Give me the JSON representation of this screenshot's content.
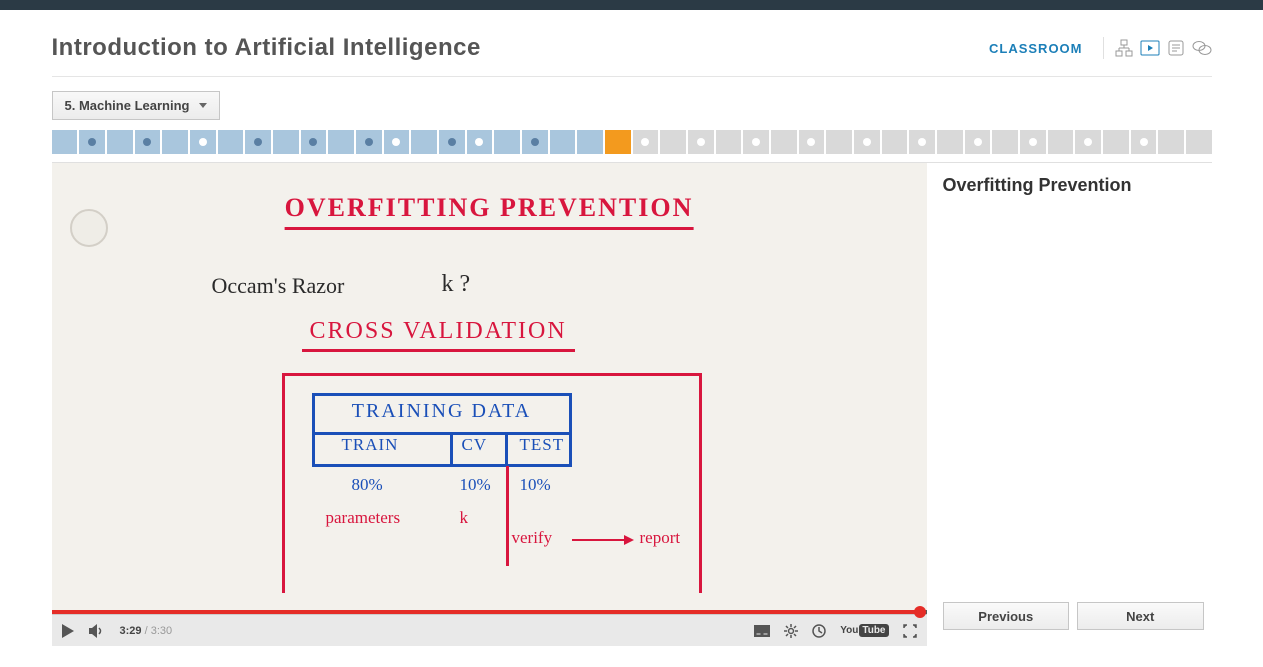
{
  "header": {
    "course_title": "Introduction to Artificial Intelligence",
    "classroom_label": "CLASSROOM"
  },
  "subnav": {
    "chapter_label": "5. Machine Learning"
  },
  "progress": {
    "segments": [
      {
        "state": "done",
        "marker": "none"
      },
      {
        "state": "done",
        "marker": "filled"
      },
      {
        "state": "done",
        "marker": "none"
      },
      {
        "state": "done",
        "marker": "filled"
      },
      {
        "state": "done",
        "marker": "none"
      },
      {
        "state": "done",
        "marker": "open"
      },
      {
        "state": "done",
        "marker": "none"
      },
      {
        "state": "done",
        "marker": "filled"
      },
      {
        "state": "done",
        "marker": "none"
      },
      {
        "state": "done",
        "marker": "filled"
      },
      {
        "state": "done",
        "marker": "none"
      },
      {
        "state": "done",
        "marker": "filled"
      },
      {
        "state": "done",
        "marker": "open"
      },
      {
        "state": "done",
        "marker": "none"
      },
      {
        "state": "done",
        "marker": "filled"
      },
      {
        "state": "done",
        "marker": "open"
      },
      {
        "state": "done",
        "marker": "none"
      },
      {
        "state": "done",
        "marker": "filled"
      },
      {
        "state": "done",
        "marker": "none"
      },
      {
        "state": "done",
        "marker": "none"
      },
      {
        "state": "current",
        "marker": "none"
      },
      {
        "state": "todo",
        "marker": "open"
      },
      {
        "state": "todo",
        "marker": "none"
      },
      {
        "state": "todo",
        "marker": "open"
      },
      {
        "state": "todo",
        "marker": "none"
      },
      {
        "state": "todo",
        "marker": "open"
      },
      {
        "state": "todo",
        "marker": "none"
      },
      {
        "state": "todo",
        "marker": "open"
      },
      {
        "state": "todo",
        "marker": "none"
      },
      {
        "state": "todo",
        "marker": "open"
      },
      {
        "state": "todo",
        "marker": "none"
      },
      {
        "state": "todo",
        "marker": "open"
      },
      {
        "state": "todo",
        "marker": "none"
      },
      {
        "state": "todo",
        "marker": "open"
      },
      {
        "state": "todo",
        "marker": "none"
      },
      {
        "state": "todo",
        "marker": "open"
      },
      {
        "state": "todo",
        "marker": "none"
      },
      {
        "state": "todo",
        "marker": "open"
      },
      {
        "state": "todo",
        "marker": "none"
      },
      {
        "state": "todo",
        "marker": "open"
      },
      {
        "state": "todo",
        "marker": "none"
      },
      {
        "state": "todo",
        "marker": "none"
      }
    ]
  },
  "side": {
    "lesson_title": "Overfitting Prevention",
    "prev_label": "Previous",
    "next_label": "Next"
  },
  "controls": {
    "current_time": "3:29",
    "total_time": " / 3:30",
    "youtube_you": "You",
    "youtube_tube": "Tube"
  },
  "whiteboard": {
    "title": "OVERFITTING PREVENTION",
    "occam": "Occam's Razor",
    "k_q": "k ?",
    "cv_title": "CROSS VALIDATION",
    "table_header": "TRAINING DATA",
    "col_train": "TRAIN",
    "col_cv": "CV",
    "col_test": "TEST",
    "pct_train": "80%",
    "pct_cv": "10%",
    "pct_test": "10%",
    "note_parameters": "parameters",
    "note_k": "k",
    "note_verify": "verify",
    "note_report": "report"
  }
}
